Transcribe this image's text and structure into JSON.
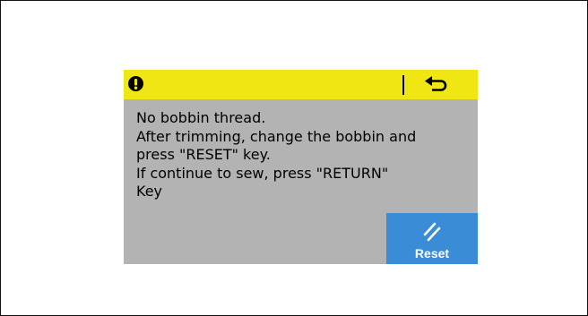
{
  "dialog": {
    "title_bar": {
      "color": "#f0e614",
      "alert_icon": "exclamation-circle-icon",
      "return_icon": "return-arrow-icon"
    },
    "message_lines": [
      "No bobbin thread.",
      "After trimming, change the bobbin and",
      "press \"RESET\" key.",
      "If continue to sew, press \"RETURN\"",
      "Key"
    ],
    "reset_button": {
      "label": "Reset",
      "icon": "double-slash-icon",
      "color": "#3a8cd6"
    },
    "background_color": "#b3b3b3"
  }
}
